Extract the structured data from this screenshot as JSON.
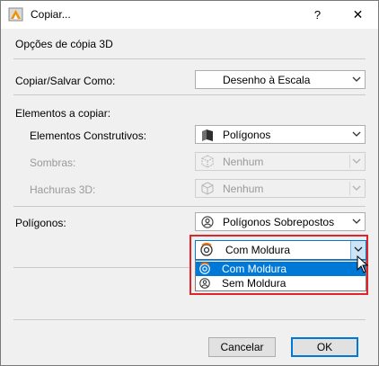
{
  "window": {
    "title": "Copiar...",
    "help_label": "?",
    "close_label": "✕"
  },
  "section_title": "Opções de cópia 3D",
  "copy_save_as": {
    "label": "Copiar/Salvar Como:",
    "value": "Desenho à Escala"
  },
  "elements_group": {
    "heading": "Elementos a copiar:",
    "construction": {
      "label": "Elementos Construtivos:",
      "value": "Polígonos"
    },
    "shadows": {
      "label": "Sombras:",
      "value": "Nenhum"
    },
    "hatches": {
      "label": "Hachuras 3D:",
      "value": "Nenhum"
    }
  },
  "polygons": {
    "label": "Polígonos:",
    "value": "Polígonos Sobrepostos",
    "frame_combo": {
      "value": "Com Moldura",
      "options": [
        "Com Moldura",
        "Sem Moldura"
      ],
      "highlighted_index": 0
    }
  },
  "buttons": {
    "cancel": "Cancelar",
    "ok": "OK"
  },
  "colors": {
    "accent": "#0078d7",
    "highlight_frame": "#e0242c"
  }
}
